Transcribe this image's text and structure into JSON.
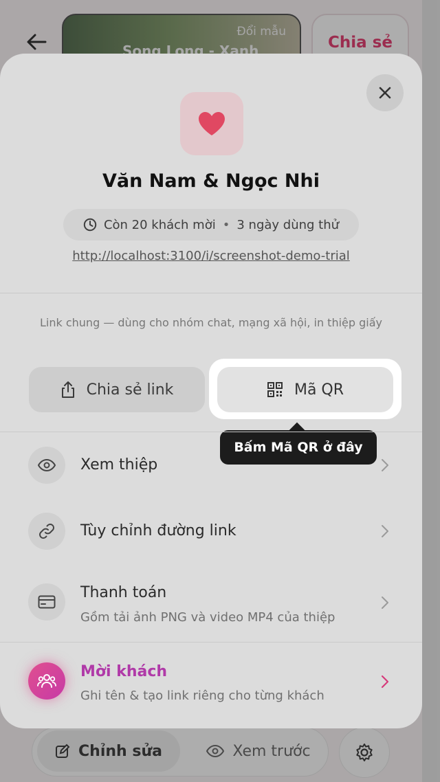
{
  "background": {
    "template_change_label": "Đổi mẫu",
    "template_name": "Song Long - Xanh",
    "top_share_label": "Chia sẻ",
    "edit_label": "Chỉnh sửa",
    "preview_label": "Xem trước"
  },
  "sheet": {
    "couple_name": "Văn Nam & Ngọc Nhi",
    "status_guests": "Còn 20 khách mời",
    "status_separator": "•",
    "status_trial": "3 ngày dùng thử",
    "invite_url": "http://localhost:3100/i/screenshot-demo-trial",
    "share_hint": "Link chung — dùng cho nhóm chat, mạng xã hội, in thiệp giấy",
    "share_link_label": "Chia sẻ link",
    "qr_label": "Mã QR",
    "tooltip": "Bấm Mã QR ở đây",
    "rows": [
      {
        "title": "Xem thiệp",
        "subtitle": ""
      },
      {
        "title": "Tùy chỉnh đường link",
        "subtitle": ""
      },
      {
        "title": "Thanh toán",
        "subtitle": "Gồm tải ảnh PNG và video MP4 của thiệp"
      }
    ],
    "invite_row": {
      "title": "Mời khách",
      "subtitle": "Ghi tên & tạo link riêng cho từng khách"
    }
  },
  "colors": {
    "accent_pink": "#e0245e",
    "invite_purple": "#b03aa8",
    "heart": "#e04862"
  }
}
